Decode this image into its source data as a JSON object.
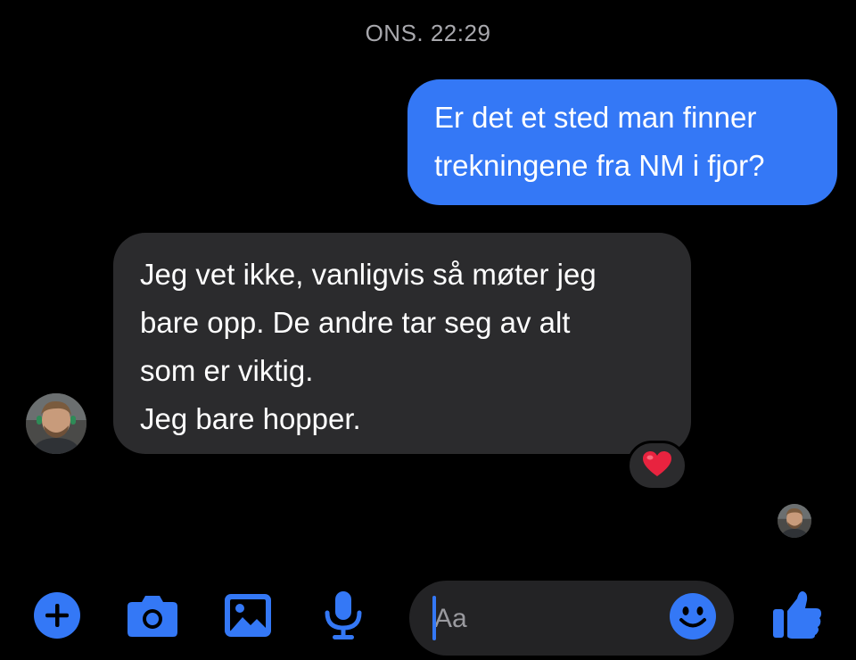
{
  "conversation": {
    "timestamp": "ONS. 22:29",
    "messages": [
      {
        "direction": "outgoing",
        "lines": [
          "Er det et sted man finner",
          "trekningene fra NM i fjor?"
        ]
      },
      {
        "direction": "incoming",
        "lines": [
          "Jeg vet ikke, vanligvis så møter jeg",
          "bare opp. De andre tar seg av alt",
          "som er viktig.",
          "Jeg bare hopper."
        ],
        "reaction": "❤️"
      }
    ]
  },
  "composer": {
    "placeholder": "Aa"
  },
  "toolbar": {
    "icons": [
      "plus-icon",
      "camera-icon",
      "gallery-icon",
      "microphone-icon",
      "emoji-icon",
      "thumbs-up-icon"
    ]
  },
  "colors": {
    "accent": "#3478f6",
    "incoming_bubble": "#2b2b2d",
    "background": "#000000",
    "timestamp": "#a8a8ad",
    "heart": "#e8233f"
  }
}
